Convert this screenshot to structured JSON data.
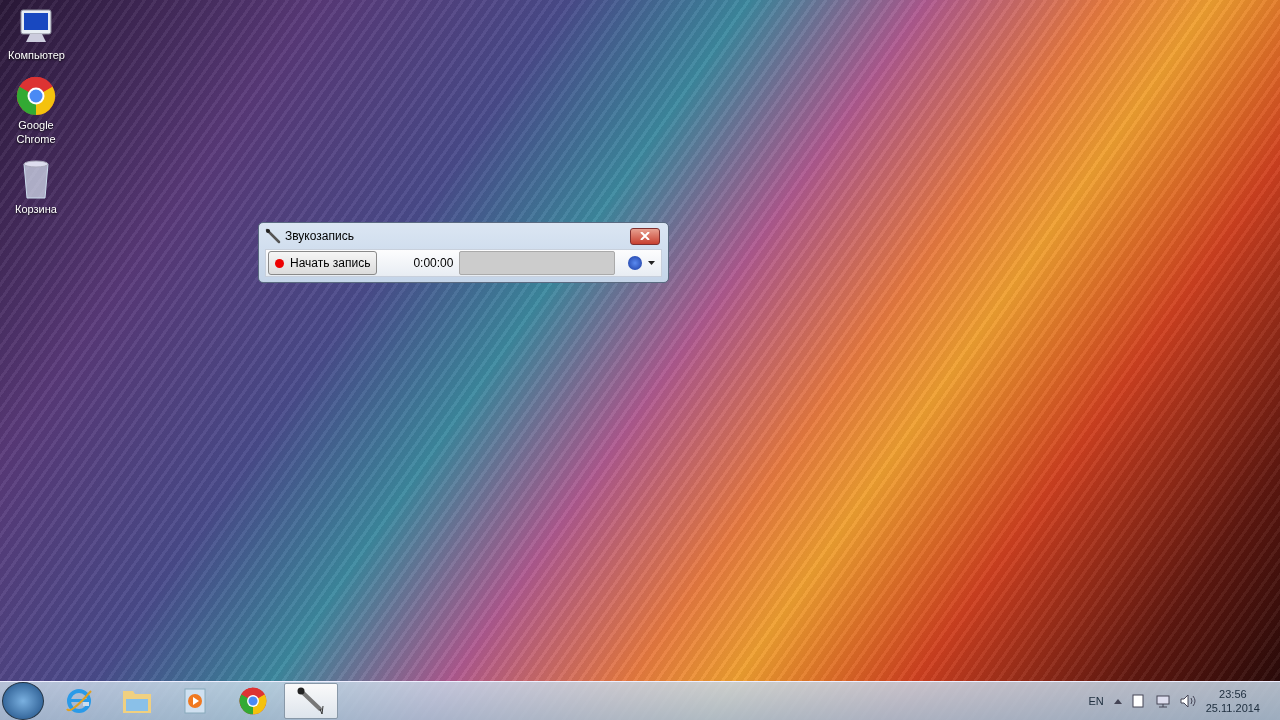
{
  "desktop_icons": [
    {
      "label": "Компьютер",
      "kind": "computer"
    },
    {
      "label": "Google Chrome",
      "kind": "chrome"
    },
    {
      "label": "Корзина",
      "kind": "bin"
    }
  ],
  "window": {
    "title": "Звукозапись",
    "record_button": "Начать запись",
    "elapsed": "0:00:00",
    "level": 0
  },
  "taskbar": {
    "apps": [
      {
        "kind": "ie",
        "selected": false
      },
      {
        "kind": "folder",
        "selected": false
      },
      {
        "kind": "media",
        "selected": false
      },
      {
        "kind": "chrome",
        "selected": false
      },
      {
        "kind": "microphone",
        "selected": true
      }
    ],
    "language": "EN",
    "time": "23:56",
    "date": "25.11.2014"
  }
}
